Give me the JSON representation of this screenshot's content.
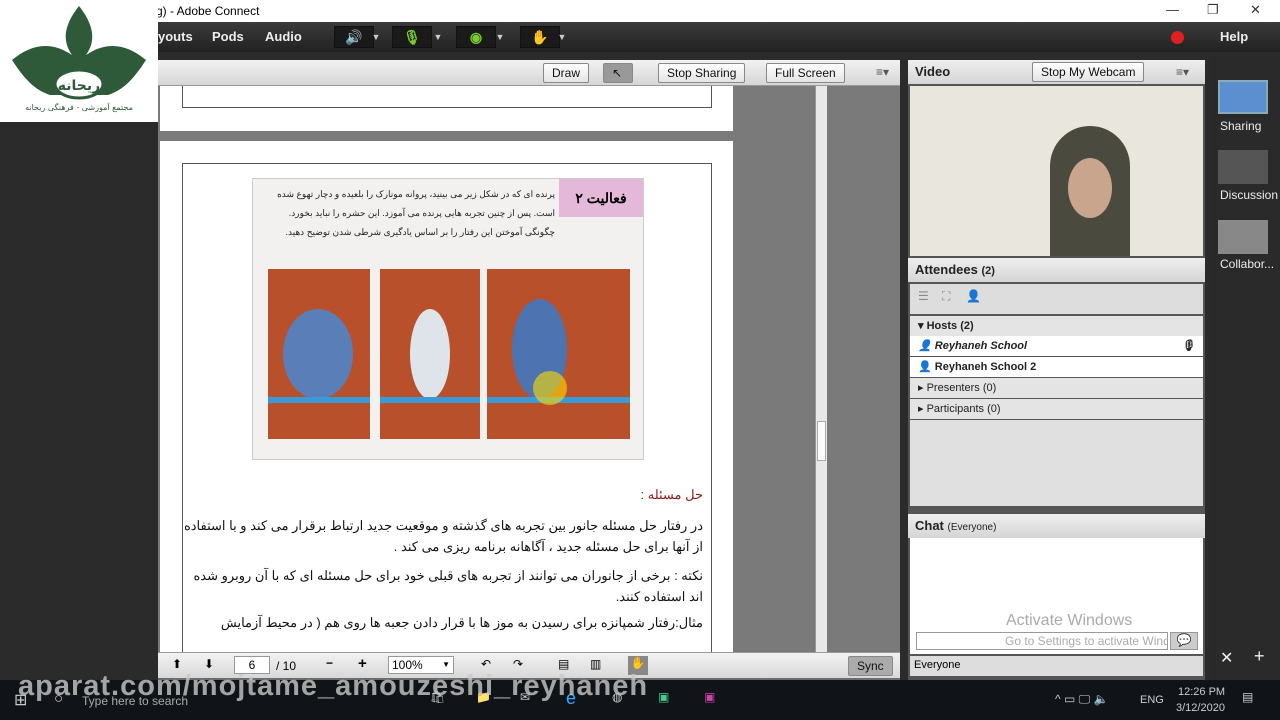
{
  "window": {
    "title": "g) - Adobe Connect",
    "minimize": "—",
    "restore": "❐",
    "close": "✕"
  },
  "logo": {
    "text": "ریحانه",
    "subtitle": "مجتمع آموزشی - فرهنگی ریحانه"
  },
  "menu": {
    "items": [
      "youts",
      "Pods",
      "Audio"
    ],
    "help": "Help"
  },
  "share": {
    "draw": "Draw",
    "stop_sharing": "Stop Sharing",
    "full_screen": "Full Screen"
  },
  "document": {
    "activity_title": "فعالیت ۲",
    "activity_text": "پرنده ای که در شکل زیر می بینید، پروانه مونارک را بلعیده و دچار تهوع شده است. پس از چنین تجربه هایی پرنده می آموزد. این حشره را نباید بخورد. چگونگی آموختن این رفتار را بر اساس یادگیری شرطی شدن توضیح دهید.",
    "heading": "حل مسئله :",
    "p1": "در رفتار حل مسئله جانور بین تجربه های گذشته و موقعیت جدید ارتباط برقرار می کند و با استفاده از آنها برای حل مسئله جدید ، آگاهانه برنامه ریزی می کند .",
    "p2": "نکته : برخی از جانوران می توانند از تجربه های قبلی خود برای حل مسئله ای که با آن روبرو شده اند استفاده کنند.",
    "p3": "مثال:رفتار شمپانزه برای رسیدن به موز ها با قرار دادن جعبه ها روی هم ( در محیط آزمایش"
  },
  "pager": {
    "page": "6",
    "total": "/ 10",
    "zoom": "100%",
    "sync": "Sync"
  },
  "video": {
    "title": "Video",
    "stop_webcam": "Stop My Webcam"
  },
  "attendees": {
    "title": "Attendees",
    "count": "(2)",
    "hosts": "Hosts (2)",
    "host_list": [
      "Reyhaneh School",
      "Reyhaneh School 2"
    ],
    "presenters": "Presenters (0)",
    "participants": "Participants (0)"
  },
  "chat": {
    "title": "Chat",
    "scope": "(Everyone)",
    "recipient": "Everyone",
    "watermark": "Activate Windows",
    "watermark2": "Go to Settings to activate Windows."
  },
  "sidebar": {
    "items": [
      "Sharing",
      "Discussion",
      "Collabor..."
    ]
  },
  "overlay": {
    "watermark": "aparat.com/mojtame_amouzeshi_reyhaneh"
  },
  "taskbar": {
    "search": "Type here to search",
    "lang": "ENG",
    "time": "12:26 PM",
    "date": "3/12/2020"
  },
  "colors": {
    "menubar": "#2b2b2b",
    "record": "#e02020",
    "audio_active": "#77cc33",
    "heading": "#8b1a1a"
  }
}
